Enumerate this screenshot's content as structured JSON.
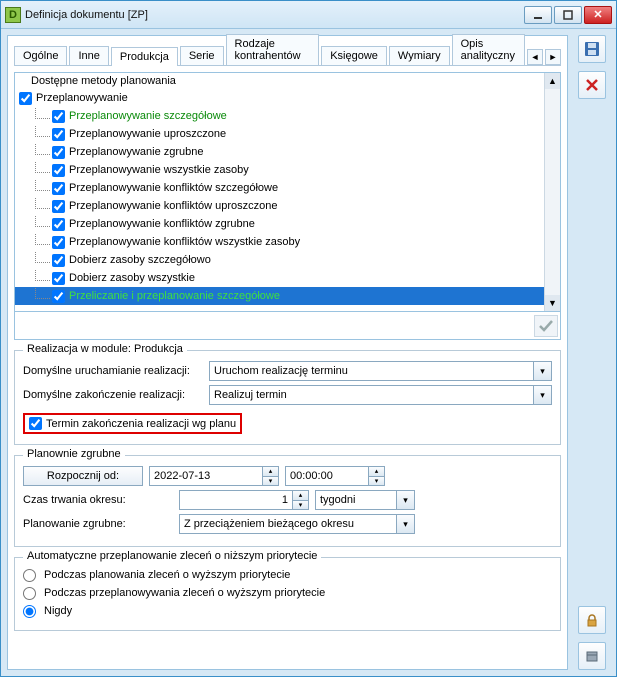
{
  "window": {
    "title": "Definicja dokumentu [ZP]"
  },
  "tabs": {
    "items": [
      "Ogólne",
      "Inne",
      "Produkcja",
      "Serie",
      "Rodzaje kontrahentów",
      "Księgowe",
      "Wymiary",
      "Opis analityczny"
    ],
    "active_index": 2
  },
  "tree": {
    "header": "Dostępne metody planowania",
    "root": {
      "label": "Przeplanowywanie",
      "checked": true
    },
    "items": [
      {
        "label": "Przeplanowywanie szczegółowe",
        "checked": true,
        "green": true
      },
      {
        "label": "Przeplanowywanie uproszczone",
        "checked": true
      },
      {
        "label": "Przeplanowywanie zgrubne",
        "checked": true
      },
      {
        "label": "Przeplanowywanie wszystkie zasoby",
        "checked": true
      },
      {
        "label": "Przeplanowywanie konfliktów szczegółowe",
        "checked": true
      },
      {
        "label": "Przeplanowywanie konfliktów uproszczone",
        "checked": true
      },
      {
        "label": "Przeplanowywanie konfliktów zgrubne",
        "checked": true
      },
      {
        "label": "Przeplanowywanie konfliktów wszystkie zasoby",
        "checked": true
      },
      {
        "label": "Dobierz zasoby szczegółowo",
        "checked": true
      },
      {
        "label": "Dobierz zasoby wszystkie",
        "checked": true
      },
      {
        "label": "Przeliczanie i przeplanowanie szczegółowe",
        "checked": true,
        "green": true,
        "selected": true
      }
    ]
  },
  "realization": {
    "legend": "Realizacja w module: Produkcja",
    "start_label": "Domyślne uruchamianie realizacji:",
    "start_value": "Uruchom realizację terminu",
    "end_label": "Domyślne zakończenie realizacji:",
    "end_value": "Realizuj termin",
    "checkbox_label": "Termin zakończenia realizacji wg planu",
    "checkbox_checked": true
  },
  "rough": {
    "legend": "Planownie zgrubne",
    "start_btn": "Rozpocznij od:",
    "date": "2022-07-13",
    "time": "00:00:00",
    "duration_label": "Czas trwania okresu:",
    "duration_value": "1",
    "duration_unit": "tygodni",
    "planning_label": "Planowanie zgrubne:",
    "planning_value": "Z przeciążeniem bieżącego okresu"
  },
  "auto": {
    "legend": "Automatyczne przeplanowanie zleceń o niższym priorytecie",
    "options": [
      "Podczas planowania zleceń o wyższym priorytecie",
      "Podczas przeplanowywania zleceń o wyższym priorytecie",
      "Nigdy"
    ],
    "selected_index": 2
  },
  "side_icons": {
    "save": "save-icon",
    "close": "close-icon",
    "lock": "lock-icon",
    "history": "history-icon"
  }
}
